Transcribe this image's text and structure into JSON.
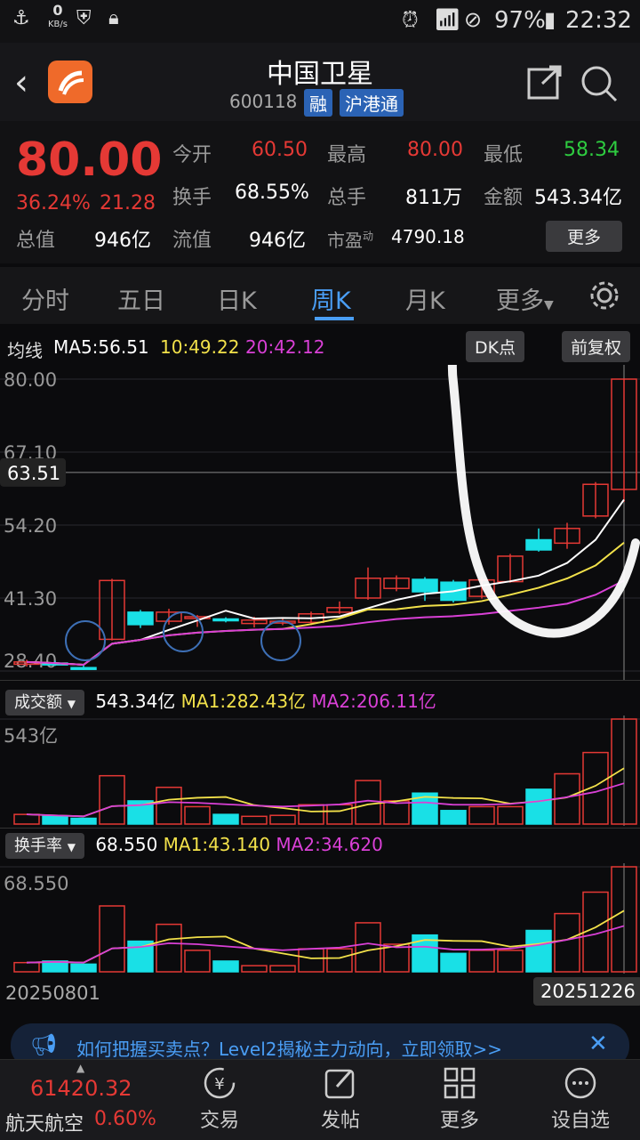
{
  "status_bar": {
    "speed": "0",
    "speed_unit": "KB/s",
    "battery": "97%",
    "time": "22:32"
  },
  "header": {
    "title": "中国卫星",
    "code": "600118",
    "tags": [
      "融",
      "沪港通"
    ]
  },
  "quote": {
    "price": "80.00",
    "change_pct": "36.24%",
    "change": "21.28",
    "total_value_label": "总值",
    "total_value": "946亿",
    "float_value_label": "流值",
    "float_value": "946亿",
    "pe_label": "市盈",
    "pe_sup": "动",
    "pe": "4790.18",
    "open_label": "今开",
    "open": "60.50",
    "high_label": "最高",
    "high": "80.00",
    "low_label": "最低",
    "low": "58.34",
    "turnover_label": "换手",
    "turnover": "68.55%",
    "volume_label": "总手",
    "volume": "811万",
    "amount_label": "金额",
    "amount": "543.34亿",
    "more": "更多"
  },
  "tabs": [
    "分时",
    "五日",
    "日K",
    "周K",
    "月K",
    "更多"
  ],
  "active_tab": "周K",
  "kline": {
    "ma_label": "均线",
    "ma5": "MA5:56.51",
    "ma10": "10:49.22",
    "ma20": "20:42.12",
    "dk_button": "DK点",
    "adjust_button": "前复权",
    "y_ticks": [
      "80.00",
      "67.10",
      "54.20",
      "41.30",
      "28.40"
    ],
    "cursor_price": "63.51"
  },
  "volume_panel": {
    "label": "成交额",
    "value": "543.34亿",
    "ma1": "MA1:282.43亿",
    "ma2": "MA2:206.11亿",
    "top": "543亿"
  },
  "turnover_panel": {
    "label": "换手率",
    "value": "68.550",
    "ma1": "MA1:43.140",
    "ma2": "MA2:34.620",
    "top": "68.550"
  },
  "date_start": "20250801",
  "date_end": "20251226",
  "banner": {
    "text": "如何把握买卖点？Level2揭秘主力动向，立即领取>>"
  },
  "bottom_nav": {
    "index_value": "61420.32",
    "index_name": "航天航空",
    "index_change": "0.60%",
    "items": [
      "交易",
      "发帖",
      "更多",
      "设自选"
    ]
  },
  "colors": {
    "up": "#e53935",
    "down": "#19e0e6",
    "ma5": "#ffffff",
    "ma10": "#f2e14a",
    "ma20": "#d940d6",
    "tab_active": "#4a9ef5"
  },
  "chart_data": {
    "type": "candlestick",
    "price_range": [
      28.4,
      80.0
    ],
    "candles": [
      {
        "o": 29.6,
        "c": 30.0,
        "h": 30.4,
        "l": 29.2
      },
      {
        "o": 29.8,
        "c": 29.6,
        "h": 30.2,
        "l": 29.3
      },
      {
        "o": 29.0,
        "c": 28.9,
        "h": 29.6,
        "l": 28.6
      },
      {
        "o": 34.0,
        "c": 44.4,
        "h": 44.7,
        "l": 33.8
      },
      {
        "o": 38.8,
        "c": 36.6,
        "h": 39.2,
        "l": 36.0
      },
      {
        "o": 37.2,
        "c": 38.8,
        "h": 39.4,
        "l": 36.6
      },
      {
        "o": 37.9,
        "c": 38.0,
        "h": 38.3,
        "l": 36.2
      },
      {
        "o": 37.6,
        "c": 37.5,
        "h": 37.9,
        "l": 37.0
      },
      {
        "o": 36.8,
        "c": 37.4,
        "h": 38.0,
        "l": 36.1
      },
      {
        "o": 36.9,
        "c": 37.2,
        "h": 37.6,
        "l": 36.5
      },
      {
        "o": 37.0,
        "c": 38.5,
        "h": 38.9,
        "l": 36.5
      },
      {
        "o": 38.8,
        "c": 39.6,
        "h": 40.7,
        "l": 38.5
      },
      {
        "o": 41.3,
        "c": 44.8,
        "h": 46.7,
        "l": 41.0
      },
      {
        "o": 43.0,
        "c": 44.8,
        "h": 45.3,
        "l": 42.5
      },
      {
        "o": 44.6,
        "c": 42.4,
        "h": 45.0,
        "l": 40.8
      },
      {
        "o": 44.1,
        "c": 40.9,
        "h": 44.5,
        "l": 40.5
      },
      {
        "o": 41.6,
        "c": 44.5,
        "h": 45.0,
        "l": 41.2
      },
      {
        "o": 44.2,
        "c": 48.7,
        "h": 49.1,
        "l": 44.0
      },
      {
        "o": 51.6,
        "c": 49.8,
        "h": 53.6,
        "l": 49.5
      },
      {
        "o": 51.0,
        "c": 53.6,
        "h": 54.6,
        "l": 50.0
      },
      {
        "o": 55.8,
        "c": 61.4,
        "h": 61.8,
        "l": 55.4
      },
      {
        "o": 60.5,
        "c": 80.0,
        "h": 80.0,
        "l": 58.3
      }
    ],
    "amount_max": 543,
    "amounts": [
      50,
      40,
      30,
      250,
      120,
      190,
      90,
      50,
      40,
      45,
      100,
      100,
      225,
      120,
      160,
      70,
      90,
      90,
      180,
      260,
      370,
      543
    ],
    "turnover_max": 68.55,
    "turnovers": [
      6,
      7,
      5,
      43,
      20,
      31,
      14,
      7,
      4,
      4,
      15,
      15,
      32,
      18,
      24,
      12,
      14,
      14,
      27,
      38,
      52,
      68.55
    ]
  }
}
